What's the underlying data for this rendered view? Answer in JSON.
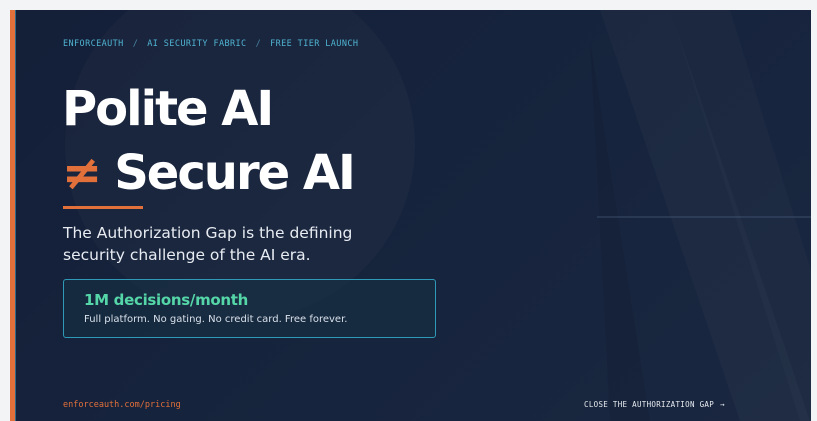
{
  "breadcrumb": {
    "items": [
      "ENFORCEAUTH",
      "AI SECURITY FABRIC",
      "FREE TIER LAUNCH"
    ],
    "separator": "/"
  },
  "headline": {
    "line1": "Polite AI",
    "neq_symbol": "≠",
    "line2": "Secure AI"
  },
  "subtitle": "The Authorization Gap is the defining security challenge of the AI era.",
  "promo": {
    "heading": "1M decisions/month",
    "subtext": "Full platform. No gating. No credit card. Free forever."
  },
  "footer": {
    "url": "enforceauth.com/pricing",
    "cta_label": "CLOSE THE AUTHORIZATION GAP",
    "cta_arrow": "→"
  },
  "colors": {
    "accent": "#e2703a",
    "promo_green": "#55d6a8",
    "link_blue": "#4fb3d1",
    "background": "#141f38"
  }
}
